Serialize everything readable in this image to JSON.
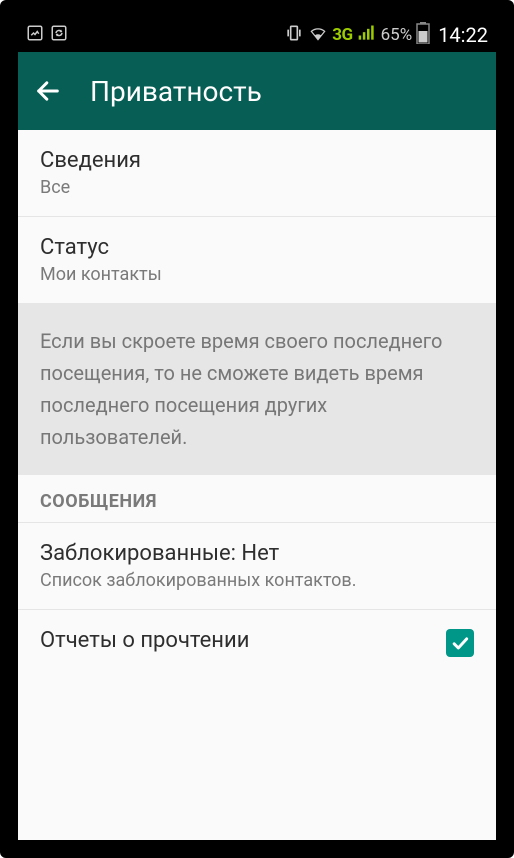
{
  "status": {
    "network_label": "3G",
    "battery_pct": "65%",
    "time": "14:22"
  },
  "appbar": {
    "title": "Приватность"
  },
  "settings": {
    "about": {
      "title": "Сведения",
      "value": "Все"
    },
    "status": {
      "title": "Статус",
      "value": "Мои контакты"
    },
    "info_text": "Если вы скроете время своего последнего посещения, то не сможете видеть время последнего посещения других пользователей.",
    "section_msgs": "СООБЩЕНИЯ",
    "blocked": {
      "title": "Заблокированные: Нет",
      "sub": "Список заблокированных контактов."
    },
    "read_receipts": {
      "title": "Отчеты о прочтении",
      "checked": true
    }
  }
}
